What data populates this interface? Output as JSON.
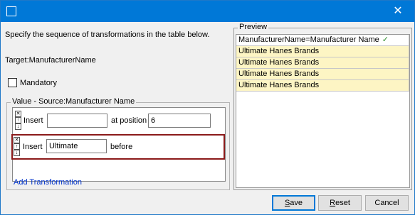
{
  "window": {
    "title": "",
    "close_glyph": "✕"
  },
  "instructions": "Specify the sequence of transformations in the table below.",
  "target_label": "Target:ManufacturerName",
  "mandatory": {
    "label": "Mandatory",
    "checked": false
  },
  "value_group": {
    "legend": "Value - Source:Manufacturer Name",
    "rows": [
      {
        "action": "Insert",
        "value": "",
        "middle_label": "at position",
        "position_value": "6"
      },
      {
        "action": "Insert",
        "value": "Ultimate",
        "suffix_label": "before"
      }
    ],
    "add_link": "Add Transformation"
  },
  "preview": {
    "legend": "Preview",
    "header": "ManufacturerName=Manufacturer Name",
    "header_check": "✓",
    "rows": [
      "Ultimate Hanes Brands",
      "Ultimate Hanes Brands",
      "Ultimate Hanes Brands",
      "Ultimate Hanes Brands"
    ]
  },
  "buttons": {
    "save_first": "S",
    "save_rest": "ave",
    "reset_first": "R",
    "reset_rest": "eset",
    "cancel": "Cancel"
  },
  "colors": {
    "title_bar": "#0078d7",
    "preview_row": "#fdf5c4",
    "highlight_border": "#8b1a1a",
    "link": "#0033cc"
  }
}
